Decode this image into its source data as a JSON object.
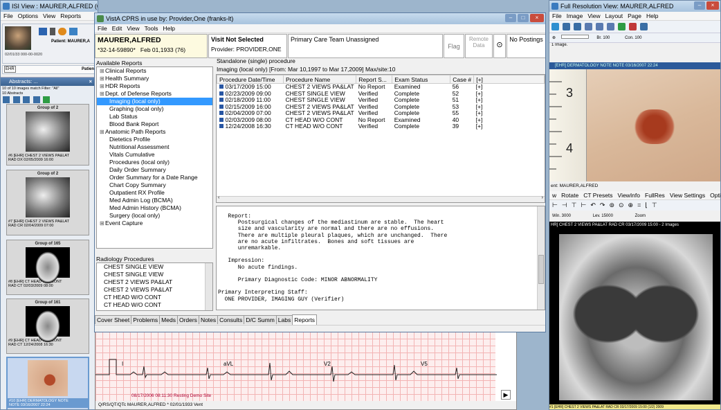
{
  "isi": {
    "title": "ISI View : MAURER,ALFRED (6",
    "menu": [
      "File",
      "Options",
      "View",
      "Reports"
    ],
    "patient_label": "Patient: MAURER,A",
    "patient_line": "02/01/33  000-00-0020",
    "ehr_label": "EHR",
    "patient_short": "Patien",
    "abstracts_title": "Abstracts: ...",
    "match_text": "10 of 10 images match Filter: \"All\"",
    "abstracts_count": "10 Abstracts",
    "thumbs": [
      {
        "group": "Group of 2",
        "caption": "#6 [EHR] CHEST 2 VIEWS PA&LAT\nRAD DX 02/05/2009 16:00"
      },
      {
        "group": "Group of 2",
        "caption": "#7 [EHR] CHEST 2 VIEWS PA&LAT\nRAD CR 02/04/2009 07:00"
      },
      {
        "group": "Group of 165",
        "caption": "#8 [EHR] CT HEAD W/O CONT\nRAD CT 02/03/2009 08:00"
      },
      {
        "group": "Group of 161",
        "caption": "#9 [EHR] CT HEAD W/O CONT\nRAD CT 12/24/2008 16:30"
      },
      {
        "group": "",
        "caption": "#10 [EHR] DERMATOLOGY NOTE\nNOTE 03/16/2007 22:24"
      }
    ]
  },
  "ecg": {
    "leads": [
      "I",
      "aVL",
      "V2",
      "V5"
    ],
    "caption": "08/17/2006 08:11:30 Resting Demo Site",
    "footer": "Q/RS/QT/QTc        MAURER,ALFRED  * 02/01/1933  Vent"
  },
  "cprs": {
    "title": "VistA CPRS in use by: Provider,One  (franks-lt)",
    "menu": [
      "File",
      "Edit",
      "View",
      "Tools",
      "Help"
    ],
    "patient_name": "MAURER,ALFRED",
    "patient_ssn": "*32-14-59890*",
    "patient_dob": "Feb 01,1933 (76)",
    "visit_label": "Visit Not Selected",
    "provider": "Provider: PROVIDER,ONE",
    "pcteam": "Primary Care Team Unassigned",
    "flag": "Flag",
    "remote_line1": "Remote",
    "remote_line2": "Data",
    "postings": "No Postings",
    "available_reports": "Available Reports",
    "reports": [
      {
        "pm": "⊞",
        "label": "Clinical Reports",
        "indent": 0
      },
      {
        "pm": "⊞",
        "label": "Health Summary",
        "indent": 0
      },
      {
        "pm": "⊞",
        "label": "HDR Reports",
        "indent": 0
      },
      {
        "pm": "⊞",
        "label": "Dept. of Defense Reports",
        "indent": 0
      },
      {
        "pm": "",
        "label": "Imaging (local only)",
        "indent": 1,
        "selected": true
      },
      {
        "pm": "",
        "label": "Graphing (local only)",
        "indent": 1
      },
      {
        "pm": "",
        "label": "Lab Status",
        "indent": 1
      },
      {
        "pm": "",
        "label": "Blood Bank Report",
        "indent": 1
      },
      {
        "pm": "⊞",
        "label": "Anatomic Path Reports",
        "indent": 0
      },
      {
        "pm": "",
        "label": "Dietetics Profile",
        "indent": 1
      },
      {
        "pm": "",
        "label": "Nutritional Assessment",
        "indent": 1
      },
      {
        "pm": "",
        "label": "Vitals Cumulative",
        "indent": 1
      },
      {
        "pm": "",
        "label": "Procedures (local only)",
        "indent": 1
      },
      {
        "pm": "",
        "label": "Daily Order Summary",
        "indent": 1
      },
      {
        "pm": "",
        "label": "Order Summary for a Date Range",
        "indent": 1
      },
      {
        "pm": "",
        "label": "Chart Copy Summary",
        "indent": 1
      },
      {
        "pm": "",
        "label": "Outpatient RX Profile",
        "indent": 1
      },
      {
        "pm": "",
        "label": "Med Admin Log (BCMA)",
        "indent": 1
      },
      {
        "pm": "",
        "label": "Med Admin History (BCMA)",
        "indent": 1
      },
      {
        "pm": "",
        "label": "Surgery (local only)",
        "indent": 1
      },
      {
        "pm": "⊞",
        "label": "Event Capture",
        "indent": 0
      }
    ],
    "radiology_label": "Radiology Procedures",
    "radiology": [
      "CHEST SINGLE VIEW",
      "CHEST SINGLE VIEW",
      "CHEST 2 VIEWS PA&LAT",
      "CHEST 2 VIEWS PA&LAT",
      "CT HEAD W/O CONT",
      "CT HEAD W/O CONT"
    ],
    "standalone": "Standalone (single) procedure",
    "imaging_range": "Imaging (local only) [From: Mar 10,1997 to Mar 17,2009]  Max/site:10",
    "columns": [
      "Procedure Date/Time",
      "Procedure Name",
      "Report S...",
      "Exam Status",
      "Case #",
      "[+]"
    ],
    "rows": [
      [
        "03/17/2009 15:00",
        "CHEST 2 VIEWS PA&LAT",
        "No Report",
        "Examined",
        "56",
        "[+]"
      ],
      [
        "02/23/2009 09:00",
        "CHEST SINGLE VIEW",
        "Verified",
        "Complete",
        "52",
        "[+]"
      ],
      [
        "02/18/2009 11:00",
        "CHEST SINGLE VIEW",
        "Verified",
        "Complete",
        "51",
        "[+]"
      ],
      [
        "02/15/2009 16:00",
        "CHEST 2 VIEWS PA&LAT",
        "Verified",
        "Complete",
        "53",
        "[+]"
      ],
      [
        "02/04/2009 07:00",
        "CHEST 2 VIEWS PA&LAT",
        "Verified",
        "Complete",
        "55",
        "[+]"
      ],
      [
        "02/03/2009 08:00",
        "CT HEAD W/O CONT",
        "No Report",
        "Examined",
        "40",
        "[+]"
      ],
      [
        "12/24/2008 16:30",
        "CT HEAD W/O CONT",
        "Verified",
        "Complete",
        "39",
        "[+]"
      ]
    ],
    "report_text": "   Report:\n      Postsurgical changes of the mediastinum are stable.  The heart\n      size and vascularity are normal and there are no effusions.\n      There are multiple pleural plaques, which are unchanged.  There\n      are no acute infiltrates.  Bones and soft tissues are\n      unremarkable.\n\n   Impression:\n      No acute findings.\n\n      Primary Diagnostic Code: MINOR ABNORMALITY\n\nPrimary Interpreting Staff:\n  ONE PROVIDER, IMAGING GUY (Verifier)",
    "tabs": [
      "Cover Sheet",
      "Problems",
      "Meds",
      "Orders",
      "Notes",
      "Consults",
      "D/C Summ",
      "Labs",
      "Reports"
    ],
    "active_tab": "Reports"
  },
  "fullres": {
    "title": "Full Resolution View: MAURER,ALFRED",
    "menu": [
      "File",
      "Image",
      "View",
      "Layout",
      "Page",
      "Help"
    ],
    "br_label": "Br. 100",
    "con_label": "Con. 100",
    "image_count": "1 Image.",
    "derm_caption": "[EHR] DERMATOLOGY NOTE NOTE 03/16/2007 22:24",
    "patient_line": "ent: MAURER,ALFRED",
    "menu2": [
      "w",
      "Rotate",
      "CT Presets",
      "ViewInfo",
      "FullRes",
      "View Settings",
      "Options"
    ],
    "win_label": "Win. 3000",
    "lev_label": "Lev. 15000",
    "zoom_label": "Zoom",
    "xray_caption": "HR] CHEST 2 VIEWS PA&LAT RAD CR 03/17/2009 15:00  - 2 Images",
    "footer": "#1 [EHR] CHEST 2 VIEWS PA&LAT RAD CR 03/17/2009 15:00 (1/2) 2009"
  }
}
